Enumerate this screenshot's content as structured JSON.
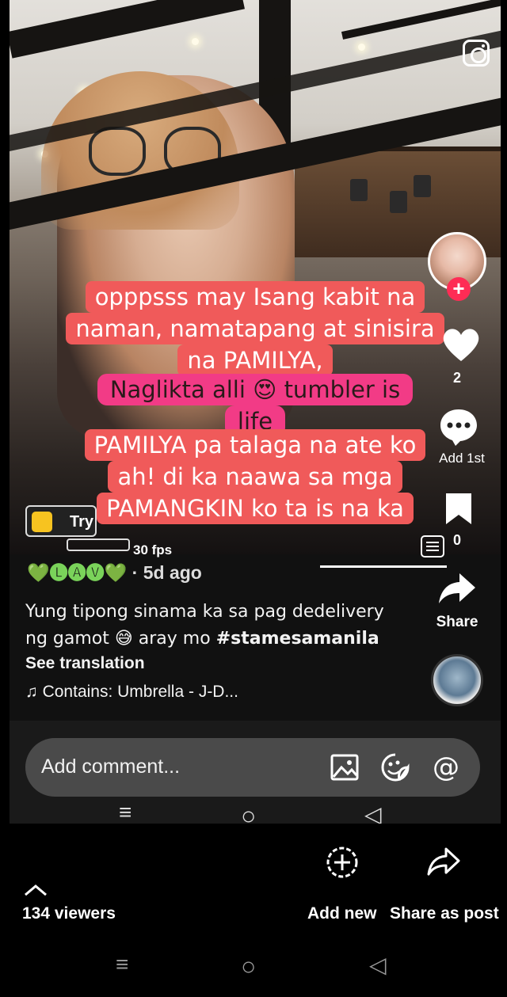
{
  "video": {
    "overlay_text_top": [
      "opppsss may Isang kabit na",
      "naman, namatapang at sinisira",
      "na PAMILYA,"
    ],
    "overlay_text_pink": [
      "Naglikta alli 😍 tumbler is",
      "life"
    ],
    "overlay_text_bottom": [
      "PAMILYA pa talaga na ate ko",
      "ah! di ka naawa sa mga",
      "PAMANGKIN ko ta is na ka"
    ],
    "fps_label": "30 fps",
    "try_label": "Try"
  },
  "rail": {
    "like_count": "2",
    "comment_label": "Add 1st",
    "save_count": "0",
    "share_label": "Share"
  },
  "post": {
    "author_line": "💚🅛🅐🅥💚",
    "time_ago": "· 5d ago",
    "caption_line1": "Yung tipong sinama ka sa pag dedelivery",
    "caption_line2_text": "ng gamot 😅 aray mo ",
    "hashtag": "#stamesamanila",
    "see_translation": "See translation",
    "music": "♫ Contains: Umbrella - J-D..."
  },
  "comment_bar": {
    "placeholder": "Add comment..."
  },
  "inner_nav": {
    "menu": "≡",
    "home": "○",
    "back": "◁"
  },
  "live_bar": {
    "viewers": "134 viewers",
    "add_new": "Add new",
    "share_as_post": "Share as post"
  },
  "system_nav": {
    "menu": "≡",
    "home": "○",
    "back": "◁"
  }
}
